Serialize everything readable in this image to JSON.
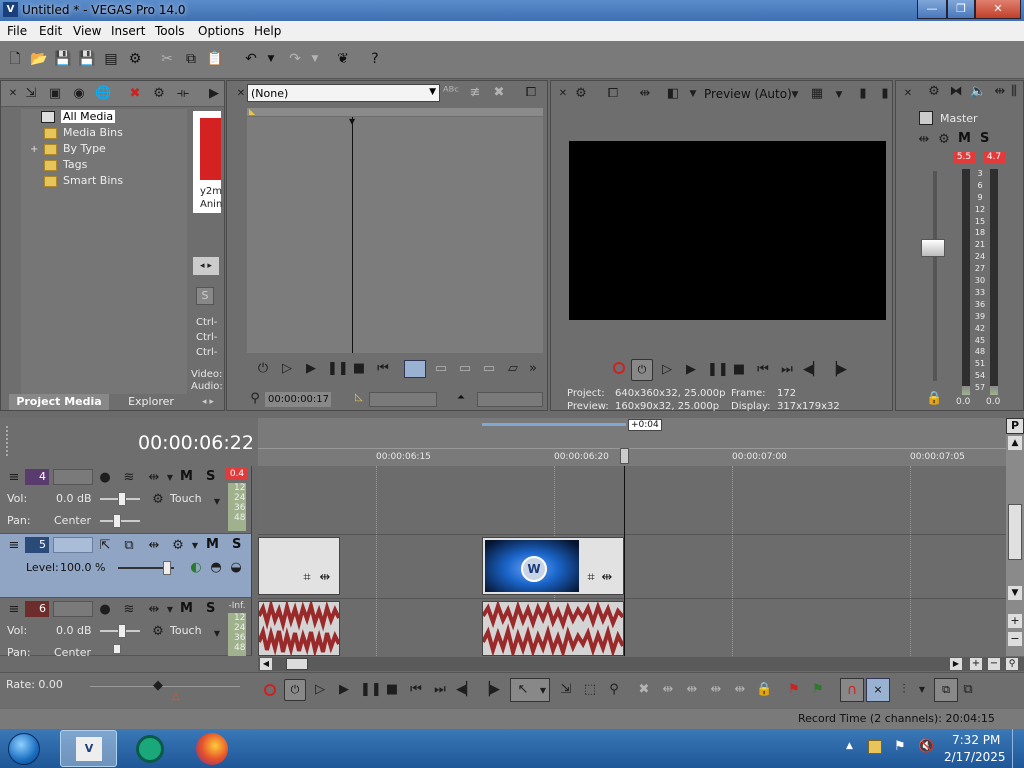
{
  "window": {
    "title": "Untitled * - VEGAS Pro 14.0",
    "app_icon_label": "V",
    "minimize": "—",
    "maximize": "❐",
    "close": "✕"
  },
  "menu": [
    "File",
    "Edit",
    "View",
    "Insert",
    "Tools",
    "Options",
    "Help"
  ],
  "project_media": {
    "tree": [
      "All Media",
      "Media Bins",
      "By Type",
      "Tags",
      "Smart Bins"
    ],
    "expand_glyph": "+",
    "thumb_text_1": "y2m",
    "thumb_text_2": "Anin",
    "side_labels": [
      "Ctrl-",
      "Ctrl-",
      "Ctrl-"
    ],
    "video_label": "Video:",
    "audio_label": "Audio:",
    "tabs": [
      "Project Media",
      "Explorer"
    ]
  },
  "trimmer": {
    "dropdown": "(None)",
    "timecode": "00:00:00:17"
  },
  "preview": {
    "mode": "Preview (Auto)",
    "project_label": "Project:",
    "project_value": "640x360x32, 25.000p",
    "preview_label": "Preview:",
    "preview_value": "160x90x32, 25.000p",
    "frame_label": "Frame:",
    "frame_value": "172",
    "display_label": "Display:",
    "display_value": "317x179x32"
  },
  "master": {
    "label": "Master",
    "m": "M",
    "s": "S",
    "peak_left": "5.5",
    "peak_right": "4.7",
    "scale": [
      "3",
      "6",
      "9",
      "12",
      "15",
      "18",
      "21",
      "24",
      "27",
      "30",
      "33",
      "36",
      "39",
      "42",
      "45",
      "48",
      "51",
      "54",
      "57"
    ],
    "bottom_left": "0.0",
    "bottom_right": "0.0",
    "fill_left": 0.04,
    "fill_right": 0.04
  },
  "timeline": {
    "timecode": "00:00:06:22",
    "zoom_badge": "+0:04",
    "ruler": [
      "00:00:06:15",
      "00:00:06:20",
      "00:00:07:00",
      "00:00:07:05"
    ],
    "tracks": [
      {
        "num": "4",
        "m": "M",
        "s": "S",
        "vol_label": "Vol:",
        "vol": "0.0 dB",
        "pan_label": "Pan:",
        "pan": "Center",
        "touch": "Touch",
        "peak": "0.4",
        "meter": [
          "12",
          "24",
          "36",
          "48"
        ]
      },
      {
        "num": "5",
        "m": "M",
        "s": "S",
        "level_label": "Level:",
        "level": "100.0 %"
      },
      {
        "num": "6",
        "m": "M",
        "s": "S",
        "vol_label": "Vol:",
        "vol": "0.0 dB",
        "pan_label": "Pan:",
        "pan": "Center",
        "touch": "Touch",
        "peak": "-Inf.",
        "meter": [
          "12",
          "24",
          "36",
          "48"
        ]
      }
    ],
    "rate": "Rate: 0.00",
    "record_time": "Record Time (2 channels): 20:04:15"
  },
  "taskbar": {
    "time": "7:32 PM",
    "date": "2/17/2025"
  },
  "colors": {
    "accent_red": "#e23b3b",
    "selected_track": "#90a4c4",
    "audio_wave": "#9a2a2a",
    "video_blue": "#1a64c8"
  }
}
